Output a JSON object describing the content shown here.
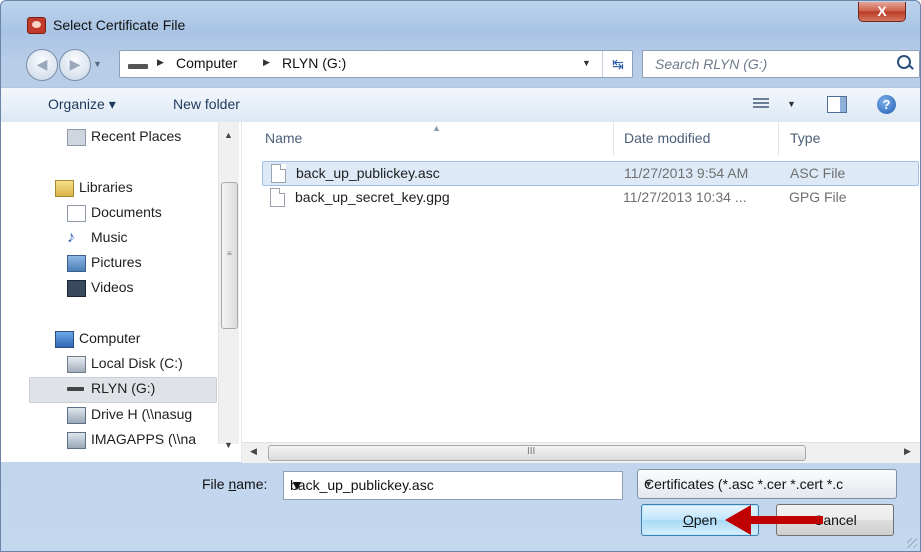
{
  "window": {
    "title": "Select Certificate File",
    "close_label": "X"
  },
  "address_bar": {
    "segments": [
      "Computer",
      "RLYN (G:)"
    ]
  },
  "search": {
    "placeholder": "Search RLYN (G:)"
  },
  "toolbar": {
    "organize_label": "Organize ▾",
    "new_folder_label": "New folder",
    "help_label": "?"
  },
  "nav_pane": {
    "items": [
      {
        "label": "Recent Places",
        "icon": "recent-places-icon"
      },
      {
        "label": "Libraries",
        "icon": "libraries-icon"
      },
      {
        "label": "Documents",
        "icon": "documents-icon"
      },
      {
        "label": "Music",
        "icon": "music-icon"
      },
      {
        "label": "Pictures",
        "icon": "pictures-icon"
      },
      {
        "label": "Videos",
        "icon": "videos-icon"
      },
      {
        "label": "Computer",
        "icon": "computer-icon"
      },
      {
        "label": "Local Disk (C:)",
        "icon": "local-disk-icon"
      },
      {
        "label": "RLYN (G:)",
        "icon": "usb-drive-icon",
        "selected": true
      },
      {
        "label": "Drive H (\\\\nasug",
        "icon": "network-drive-icon"
      },
      {
        "label": "IMAGAPPS (\\\\na",
        "icon": "network-drive-icon"
      }
    ]
  },
  "file_list": {
    "columns": {
      "name": "Name",
      "date": "Date modified",
      "type": "Type"
    },
    "rows": [
      {
        "name": "back_up_publickey.asc",
        "date": "11/27/2013 9:54 AM",
        "type": "ASC File",
        "selected": true
      },
      {
        "name": "back_up_secret_key.gpg",
        "date": "11/27/2013 10:34 ...",
        "type": "GPG File",
        "selected": false
      }
    ]
  },
  "bottom": {
    "file_name_label_prefix": "File ",
    "file_name_label_underlined": "n",
    "file_name_label_suffix": "ame:",
    "file_name_value": "back_up_publickey.asc",
    "filter_value": "Certificates (*.asc *.cer *.cert *.c",
    "open_label_underlined": "O",
    "open_label_rest": "pen",
    "cancel_label": "Cancel"
  },
  "colors": {
    "annotation_arrow": "#c00000",
    "selection": "#dde9f7"
  }
}
